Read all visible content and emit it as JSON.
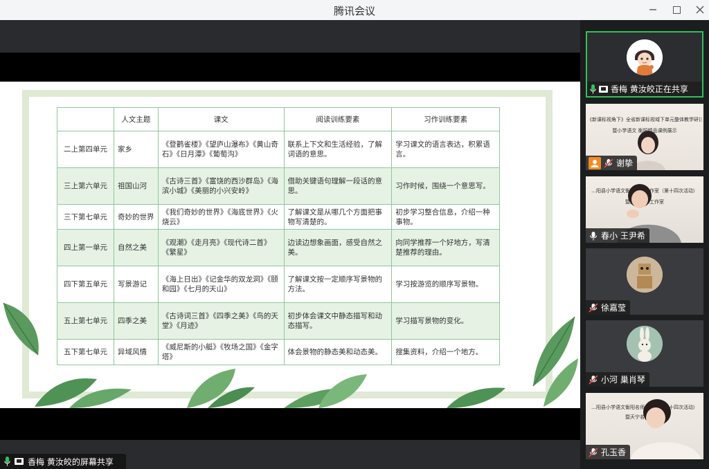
{
  "window": {
    "title": "腾讯会议"
  },
  "share_bar": {
    "label": "香梅 黄汝皎的屏幕共享"
  },
  "slide": {
    "headers": [
      "",
      "人文主题",
      "课文",
      "阅读训练要素",
      "习作训练要素"
    ],
    "rows": [
      {
        "unit": "二上第四单元",
        "theme": "家乡",
        "texts": "《登鹳雀楼》《望庐山瀑布》《黄山奇石》《日月潭》《葡萄沟》",
        "reading": "联系上下文和生活经验，了解词语的意思。",
        "writing": "学习课文的语言表达，积累语言。"
      },
      {
        "unit": "三上第六单元",
        "theme": "祖国山河",
        "texts": "《古诗三首》《富饶的西沙群岛》《海滨小城》《美丽的小兴安岭》",
        "reading": "借助关键语句理解一段话的意思。",
        "writing": "习作时候，围绕一个意思写。"
      },
      {
        "unit": "三下第七单元",
        "theme": "奇妙的世界",
        "texts": "《我们奇妙的世界》《海底世界》《火烧云》",
        "reading": "了解课文是从哪几个方面把事物写清楚的。",
        "writing": "初步学习整合信息，介绍一种事物。"
      },
      {
        "unit": "四上第一单元",
        "theme": "自然之美",
        "texts": "《观潮》《走月亮》《现代诗二首》《繁星》",
        "reading": "边读边想象画面，感受自然之美。",
        "writing": "向同学推荐一个好地方，写清楚推荐的理由。"
      },
      {
        "unit": "四下第五单元",
        "theme": "写景游记",
        "texts": "《海上日出》《记金华的双龙洞》《颐和园》《七月的天山》",
        "reading": "了解课文按一定顺序写景物的方法。",
        "writing": "学习按游览的顺序写景物。"
      },
      {
        "unit": "五上第七单元",
        "theme": "四季之美",
        "texts": "《古诗词三首》《四季之美》《鸟的天堂》《月迹》",
        "reading": "初步体会课文中静态描写和动态描写。",
        "writing": "学习描写景物的变化。"
      },
      {
        "unit": "五下第七单元",
        "theme": "异域风情",
        "texts": "《威尼斯的小艇》《牧场之国》《金字塔》",
        "reading": "体会景物的静态美和动态美。",
        "writing": "搜集资料，介绍一个地方。"
      }
    ]
  },
  "participants": [
    {
      "name": "香梅 黄汝皎正在共享",
      "icon": "cartoon-girl-avatar",
      "active": true
    },
    {
      "name": "谢挚",
      "banner": "《新课标视角下》全省新课标视域下单元整体教学研讨活动",
      "banner2": "暨小学语文 衡阳精品课例展示",
      "host": true
    },
    {
      "name": "春小 王尹希",
      "banner": "…阳县小学语文衡阳名师工作室（第十四次活动）",
      "banner2": "暨天宁名师工作室"
    },
    {
      "name": "徐嘉莹",
      "icon": "robot-toy-avatar"
    },
    {
      "name": "小河 巢肖琴",
      "icon": "rabbit-avatar"
    },
    {
      "name": "孔玉香",
      "banner": "…阳县小学语文衡阳名师工作室（第十四次活动）",
      "banner2": "暨天宁名师工作室"
    }
  ],
  "colors": {
    "accent_green": "#2fc25b",
    "table_border": "#8fc59c",
    "table_band": "#e6f3e4",
    "frame": "#dfe9d4",
    "mic_off": "#e24b4b"
  }
}
